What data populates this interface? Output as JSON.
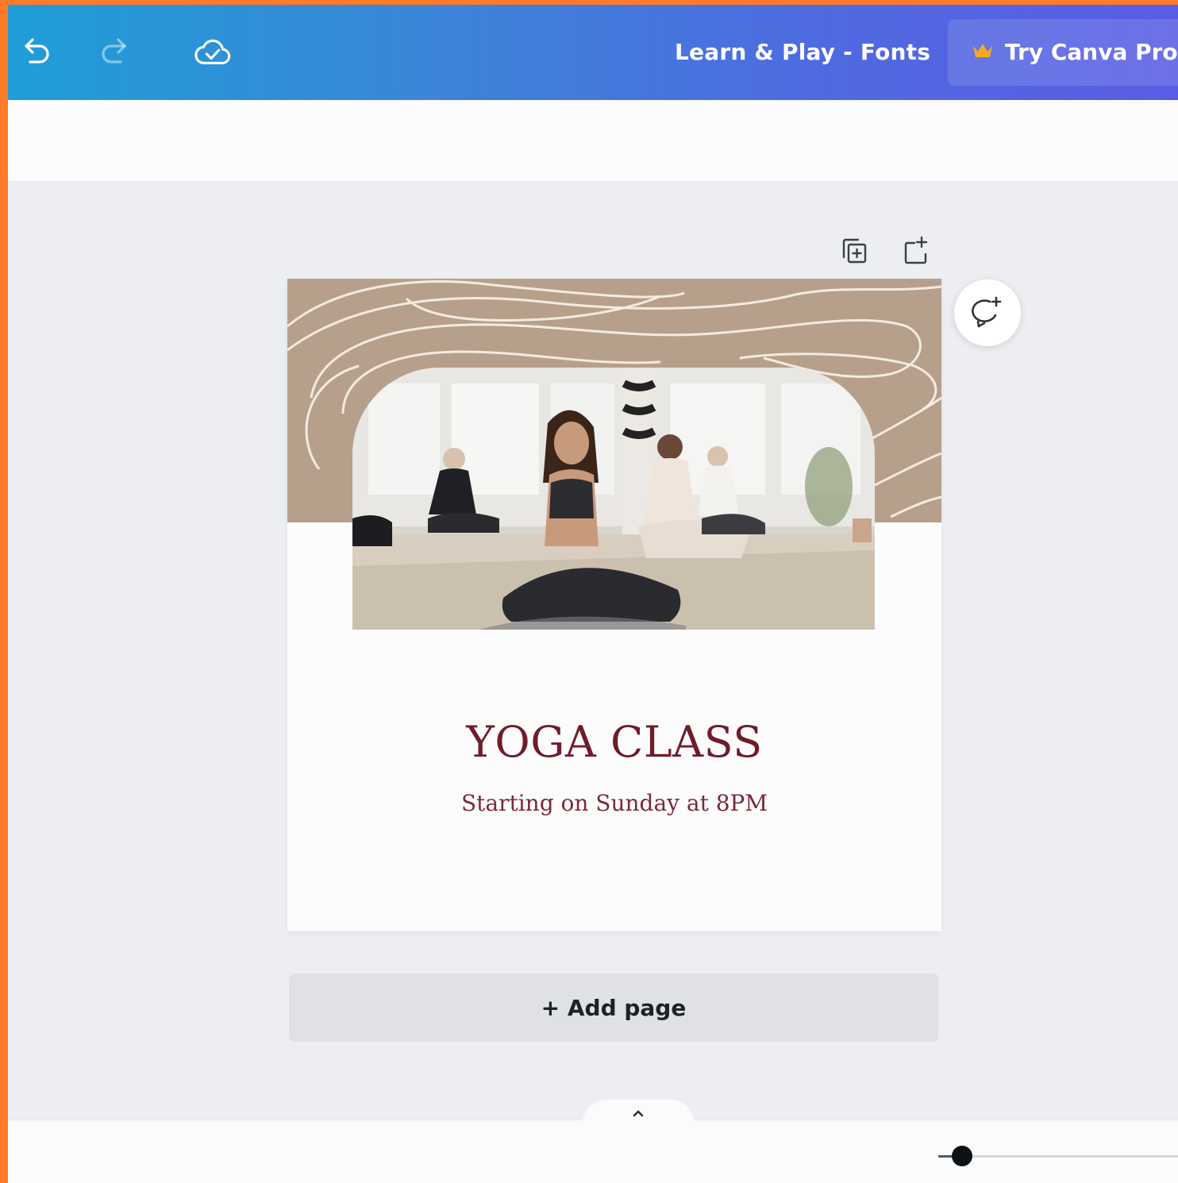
{
  "header": {
    "undo_icon": "undo-icon",
    "redo_icon": "redo-icon",
    "saved_icon": "cloud-check-icon",
    "document_title": "Learn & Play - Fonts",
    "pro_button_label": "Try Canva Pro",
    "pro_icon": "crown-icon",
    "accent_gradient": [
      "#1f9ed7",
      "#5a5de4"
    ]
  },
  "page_controls": {
    "duplicate_icon": "duplicate-page-icon",
    "add_icon": "add-page-icon",
    "comment_icon": "add-comment-icon"
  },
  "design": {
    "title": "YOGA CLASS",
    "subtitle": "Starting on Sunday at 8PM",
    "band_color": "#b6a08c",
    "title_color": "#6f1c2a"
  },
  "add_page_label": "+ Add page",
  "footer": {
    "expand_icon": "chevron-up-icon",
    "zoom_level": 0.1
  }
}
